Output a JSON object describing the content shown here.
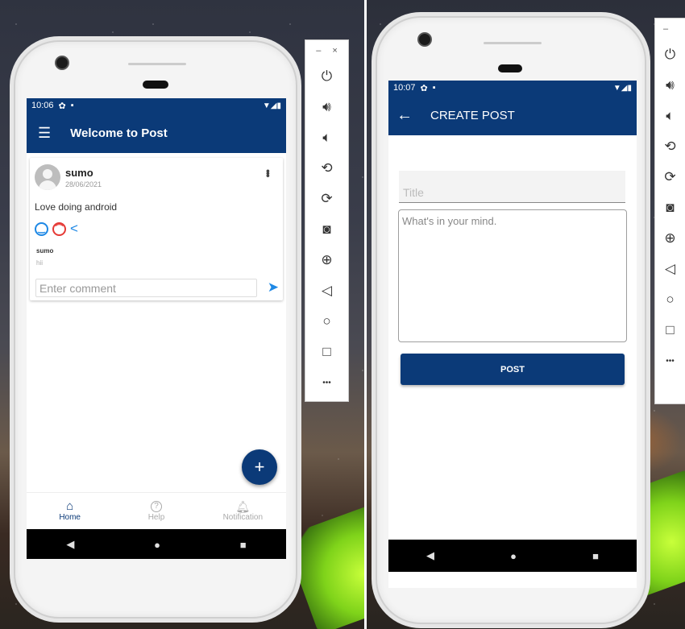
{
  "left_app": {
    "status": {
      "time": "10:06",
      "icons": "▼◢▮"
    },
    "appbar": {
      "menu_icon": "menu-icon",
      "title": "Welcome to Post"
    },
    "post": {
      "author": "sumo",
      "date": "28/06/2021",
      "content": "Love doing android",
      "comment": {
        "author": "sumo",
        "text": "hii"
      },
      "comment_placeholder": "Enter comment"
    },
    "fab_label": "+",
    "bottom_nav": {
      "home_label": "Home",
      "help_label": "Help",
      "notification_label": "Notification"
    }
  },
  "right_app": {
    "status": {
      "time": "10:07",
      "icons": "▼◢▮"
    },
    "appbar": {
      "title": "CREATE POST"
    },
    "form": {
      "title_placeholder": "Title",
      "body_placeholder": "What's in your mind.",
      "post_button": "POST"
    }
  },
  "nav_buttons": {
    "back": "◀",
    "home": "●",
    "recents": "■"
  },
  "emulator_panel": {
    "minimize": "–",
    "close": "×",
    "more": "•••"
  },
  "colors": {
    "primary": "#0b3a78",
    "happy": "#1e88e5",
    "sad": "#e53935"
  }
}
